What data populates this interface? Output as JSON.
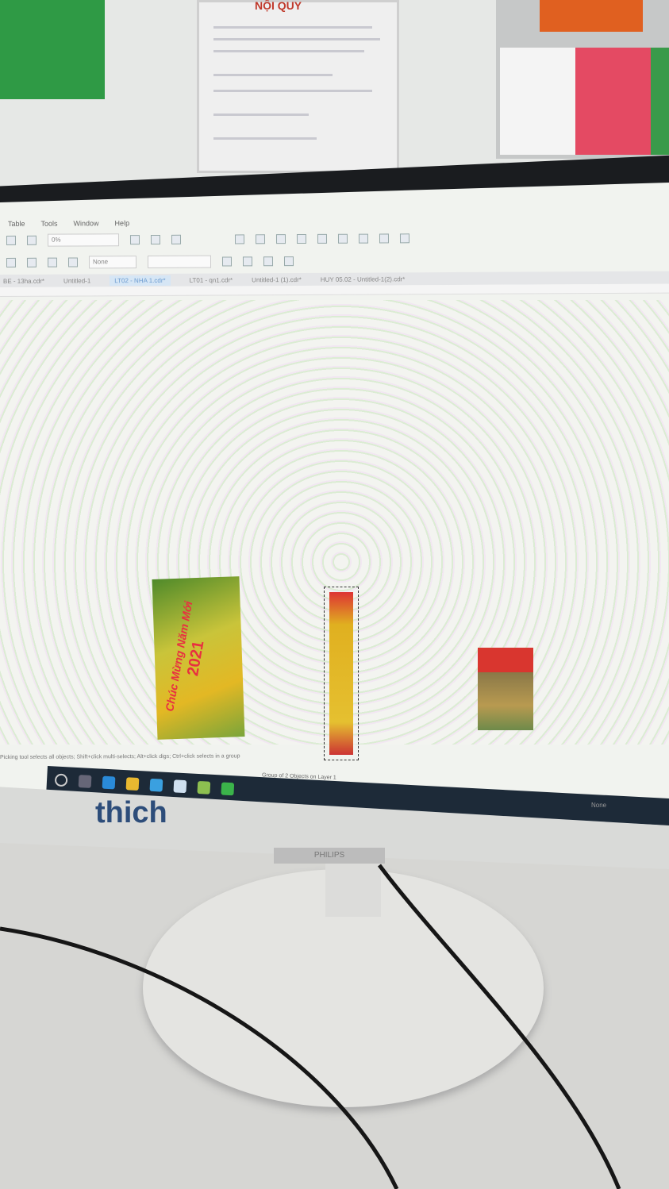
{
  "menu": [
    "Table",
    "Tools",
    "Window",
    "Help"
  ],
  "toolbar": {
    "zoom_field": "0%",
    "outline_field": "None"
  },
  "tabs": [
    {
      "label": "BE - 13ha.cdr*"
    },
    {
      "label": "Untitled-1"
    },
    {
      "label": "LT02 - NHA 1.cdr*",
      "active": true
    },
    {
      "label": "LT01 - qn1.cdr*"
    },
    {
      "label": "Untitled-1 (1).cdr*"
    },
    {
      "label": "HUY 05.02 - Untitled-1(2).cdr*"
    }
  ],
  "canvas": {
    "card_text": "Chúc Mừng Năm Mới",
    "card_year": "2021"
  },
  "status": {
    "hint": "Picking tool selects all objects; Shift+click multi-selects; Alt+click digs; Ctrl+click selects in a group",
    "selection": "Group of 2 Objects on Layer 1",
    "fill": "None"
  },
  "monitor": {
    "sticker": "thich",
    "brand": "PHILIPS"
  },
  "poster_title": "NỘI QUY"
}
